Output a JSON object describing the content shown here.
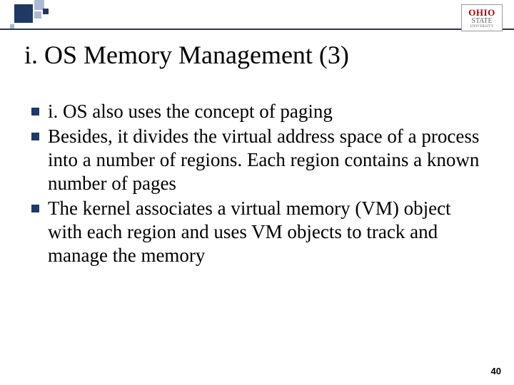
{
  "logo": {
    "line1": "OHIO",
    "line2": "STATE",
    "line3": "UNIVERSITY"
  },
  "title": "i. OS Memory Management (3)",
  "bullets": [
    "i. OS also uses the concept of paging",
    "Besides, it divides the virtual address space of a process into a number of regions. Each region contains a known number of pages",
    "The kernel associates a virtual memory (VM) object with each region and uses VM objects to track and manage the memory"
  ],
  "page_number": "40"
}
